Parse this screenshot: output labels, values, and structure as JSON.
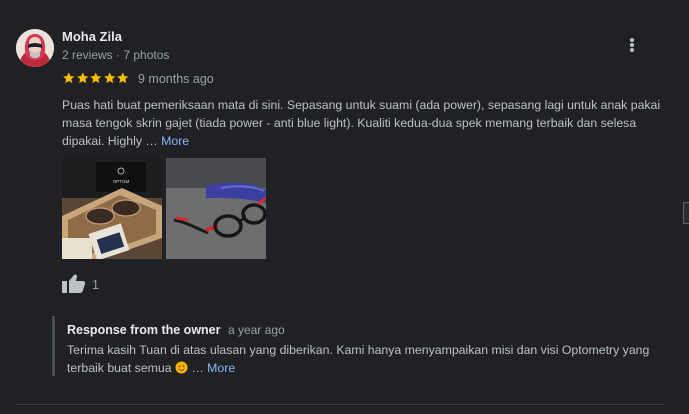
{
  "review": {
    "author_name": "Moha Zila",
    "author_meta": "2 reviews · 7 photos",
    "rating_stars": 5,
    "rating_max": 5,
    "date": "9 months ago",
    "text": "Puas hati buat pemeriksaan mata di sini. Sepasang untuk suami (ada power), sepasang lagi untuk anak pakai masa tengok skrin gajet (tiada power - anti blue light).  Kualiti kedua-dua spek memang terbaik dan selesa dipakai. Highly …",
    "more_label": "More",
    "like_count": "1",
    "photo_brand_text": "OPTOM"
  },
  "owner_response": {
    "title": "Response from the owner",
    "date": "a year ago",
    "text": "Terima kasih Tuan di atas ulasan yang diberikan. Kami hanya menyampaikan misi dan visi Optometry yang terbaik buat semua",
    "ellipsis": "…",
    "more_label": "More"
  },
  "icons": {
    "avatar": "avatar-hijab-profile",
    "menu": "more-vertical-icon",
    "star": "star-icon",
    "like": "thumbs-up-icon",
    "emoji": "smiling-face-emoji"
  },
  "colors": {
    "background": "#202124",
    "text": "#bdc1c6",
    "secondary_text": "#9aa0a6",
    "heading": "#e8eaed",
    "link": "#8ab4f8",
    "star": "#fbbc04"
  }
}
